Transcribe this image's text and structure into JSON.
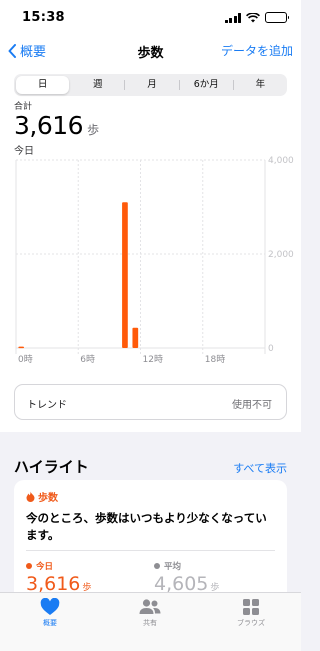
{
  "status": {
    "time": "15:38"
  },
  "nav": {
    "back_label": "概要",
    "title": "歩数",
    "add_label": "データを追加"
  },
  "segments": {
    "items": [
      "日",
      "週",
      "月",
      "6か月",
      "年"
    ],
    "selected": "日"
  },
  "summary": {
    "total_label": "合計",
    "total_value": "3,616",
    "unit": "歩",
    "date_label": "今日"
  },
  "chart_data": {
    "type": "bar",
    "x": [
      0,
      10,
      11
    ],
    "values": [
      30,
      3100,
      430
    ],
    "xlim": [
      0,
      24
    ],
    "ylim": [
      0,
      4000
    ],
    "x_ticks": [
      "0時",
      "6時",
      "12時",
      "18時"
    ],
    "y_ticks": [
      "0",
      "2,000",
      "4,000"
    ],
    "color": "#ff5a0a",
    "grid": true
  },
  "trend": {
    "label": "トレンド",
    "status": "使用不可"
  },
  "highlights": {
    "title": "ハイライト",
    "show_all": "すべて表示",
    "category": "歩数",
    "message": "今のところ、歩数はいつもより少なくなっています。",
    "today_label": "今日",
    "today_value": "3,616",
    "today_unit": "歩",
    "avg_label": "平均",
    "avg_value": "4,605",
    "avg_unit": "歩"
  },
  "tabs": [
    {
      "label": "概要",
      "icon": "heart-icon",
      "active": true
    },
    {
      "label": "共有",
      "icon": "people-icon",
      "active": false
    },
    {
      "label": "ブラウズ",
      "icon": "grid-icon",
      "active": false
    }
  ],
  "colors": {
    "accent": "#1a7cf3",
    "steps": "#f05a1a"
  }
}
